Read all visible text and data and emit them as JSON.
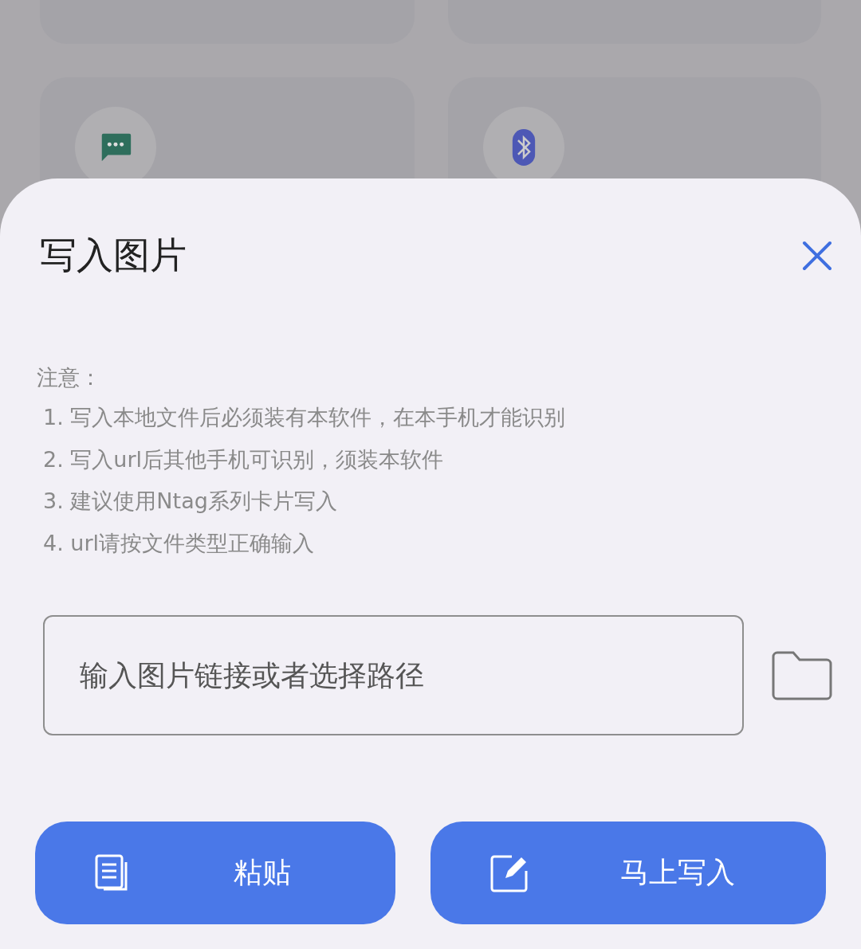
{
  "background_tiles": [
    {
      "kind": "blank"
    },
    {
      "kind": "blank"
    },
    {
      "kind": "message"
    },
    {
      "kind": "bluetooth"
    }
  ],
  "dialog": {
    "title": "写入图片",
    "note_heading": "注意：",
    "notes": [
      "1. 写入本地文件后必须装有本软件，在本手机才能识别",
      "2. 写入url后其他手机可识别，须装本软件",
      "3. 建议使用Ntag系列卡片写入",
      "4. url请按文件类型正确输入"
    ],
    "input": {
      "placeholder": "输入图片链接或者选择路径"
    },
    "buttons": [
      {
        "kind": "paste",
        "label": "粘贴"
      },
      {
        "kind": "write",
        "label": "马上写入"
      }
    ]
  }
}
